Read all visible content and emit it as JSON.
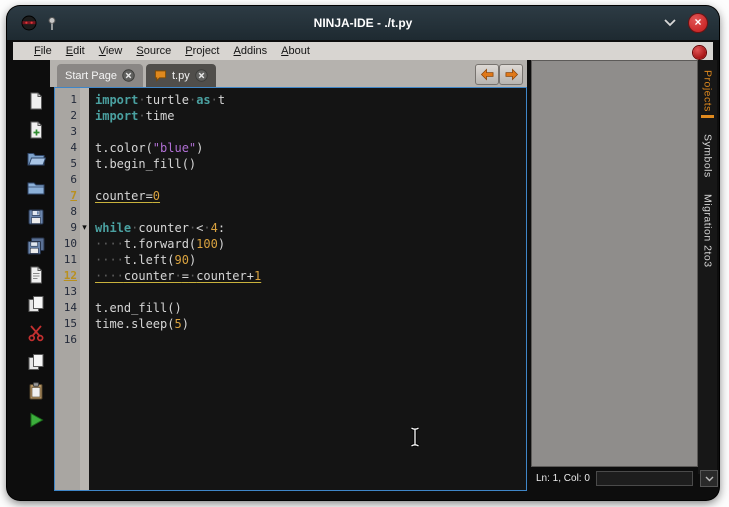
{
  "window": {
    "title": "NINJA-IDE - ./t.py",
    "controls": {
      "close": "×"
    }
  },
  "menubar": {
    "items": [
      "File",
      "Edit",
      "View",
      "Source",
      "Project",
      "Addins",
      "About"
    ]
  },
  "tabbar": {
    "tabs": [
      {
        "label": "Start Page",
        "active": false,
        "has_file_icon": false
      },
      {
        "label": "t.py",
        "active": true,
        "has_file_icon": true
      }
    ]
  },
  "toolbar": {
    "buttons": [
      {
        "name": "new-file-button",
        "icon": "page"
      },
      {
        "name": "new-tab-button",
        "icon": "page-plus"
      },
      {
        "name": "open-file-button",
        "icon": "folder-open"
      },
      {
        "name": "open-project-button",
        "icon": "folder"
      },
      {
        "name": "save-button",
        "icon": "floppy"
      },
      {
        "name": "save-all-button",
        "icon": "floppy-multi"
      },
      {
        "name": "print-button",
        "icon": "page-lines"
      },
      {
        "name": "duplicate-button",
        "icon": "copy-pages"
      },
      {
        "name": "cut-button",
        "icon": "scissors"
      },
      {
        "name": "copy-button",
        "icon": "copy-pages"
      },
      {
        "name": "paste-button",
        "icon": "clipboard"
      },
      {
        "name": "run-button",
        "icon": "run"
      }
    ]
  },
  "editor": {
    "language": "python",
    "fold_line": 9,
    "warning_lines": [
      7,
      12
    ],
    "lines": [
      {
        "n": 1,
        "tokens": [
          [
            "kw",
            "import"
          ],
          [
            "ws",
            "·"
          ],
          [
            "txt",
            "turtle"
          ],
          [
            "ws",
            "·"
          ],
          [
            "kw",
            "as"
          ],
          [
            "ws",
            "·"
          ],
          [
            "txt",
            "t"
          ]
        ]
      },
      {
        "n": 2,
        "tokens": [
          [
            "kw",
            "import"
          ],
          [
            "ws",
            "·"
          ],
          [
            "txt",
            "time"
          ]
        ]
      },
      {
        "n": 3,
        "tokens": []
      },
      {
        "n": 4,
        "tokens": [
          [
            "txt",
            "t.color("
          ],
          [
            "str",
            "\"blue\""
          ],
          [
            "txt",
            ")"
          ]
        ]
      },
      {
        "n": 5,
        "tokens": [
          [
            "txt",
            "t.begin_fill()"
          ]
        ]
      },
      {
        "n": 6,
        "tokens": []
      },
      {
        "n": 7,
        "tokens": [
          [
            "txt",
            "counter="
          ],
          [
            "num",
            "0"
          ]
        ]
      },
      {
        "n": 8,
        "tokens": []
      },
      {
        "n": 9,
        "tokens": [
          [
            "kw",
            "while"
          ],
          [
            "ws",
            "·"
          ],
          [
            "txt",
            "counter"
          ],
          [
            "ws",
            "·"
          ],
          [
            "txt",
            "<"
          ],
          [
            "ws",
            "·"
          ],
          [
            "num",
            "4"
          ],
          [
            "txt",
            ":"
          ]
        ]
      },
      {
        "n": 10,
        "tokens": [
          [
            "ws",
            "····"
          ],
          [
            "txt",
            "t.forward("
          ],
          [
            "num",
            "100"
          ],
          [
            "txt",
            ")"
          ]
        ]
      },
      {
        "n": 11,
        "tokens": [
          [
            "ws",
            "····"
          ],
          [
            "txt",
            "t.left("
          ],
          [
            "num",
            "90"
          ],
          [
            "txt",
            ")"
          ]
        ]
      },
      {
        "n": 12,
        "tokens": [
          [
            "ws",
            "····"
          ],
          [
            "txt",
            "counter"
          ],
          [
            "ws",
            "·"
          ],
          [
            "txt",
            "="
          ],
          [
            "ws",
            "·"
          ],
          [
            "txt",
            "counter+"
          ],
          [
            "num",
            "1"
          ]
        ]
      },
      {
        "n": 13,
        "tokens": []
      },
      {
        "n": 14,
        "tokens": [
          [
            "txt",
            "t.end_fill()"
          ]
        ]
      },
      {
        "n": 15,
        "tokens": [
          [
            "txt",
            "time.sleep("
          ],
          [
            "num",
            "5"
          ],
          [
            "txt",
            ")"
          ]
        ]
      },
      {
        "n": 16,
        "tokens": []
      }
    ]
  },
  "side_panel": {
    "tabs": [
      {
        "label": "Projects",
        "active": true
      },
      {
        "label": "Symbols",
        "active": false
      },
      {
        "label": "Migration 2to3",
        "active": false
      }
    ]
  },
  "statusbar": {
    "position": "Ln: 1, Col: 0"
  },
  "colors": {
    "accent": "#e08a1e",
    "keyword": "#4aa0a0",
    "string": "#b06fd4",
    "number": "#d9a23f",
    "warning": "#c9b23c",
    "close": "#cc2a2a",
    "run": "#3db03d"
  }
}
